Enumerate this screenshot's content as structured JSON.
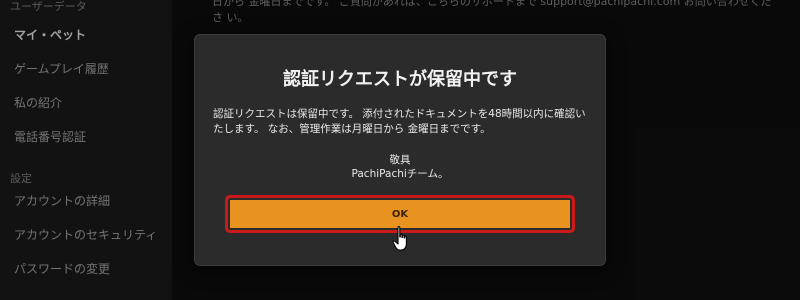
{
  "background": {
    "notice_text": "日から 金曜日までです。 ご質問があれば、こちらのサポートまで support@pachipachi.com お問い合わせくださ い。",
    "sidebar": {
      "section_user_data": "ユーザーデータ",
      "section_settings": "設定",
      "items": [
        {
          "label": "マイ・ペット"
        },
        {
          "label": "ゲームプレイ履歴"
        },
        {
          "label": "私の紹介"
        },
        {
          "label": "電話番号認証"
        },
        {
          "label": "アカウントの詳細"
        },
        {
          "label": "アカウントのセキュリティ"
        },
        {
          "label": "パスワードの変更"
        }
      ]
    }
  },
  "modal": {
    "title": "認証リクエストが保留中です",
    "body": "認証リクエストは保留中です。 添付されたドキュメントを48時間以内に確認いたします。 なお、管理作業は月曜日から 金曜日までです。",
    "signoff_line1": "敬具",
    "signoff_line2": "PachiPachiチーム。",
    "ok_label": "OK"
  },
  "colors": {
    "modal_bg": "#2b2b2b",
    "ok_button": "#e8931f",
    "highlight_border": "#cc1a1a"
  },
  "icons": {
    "cursor": "hand-pointer-icon"
  }
}
